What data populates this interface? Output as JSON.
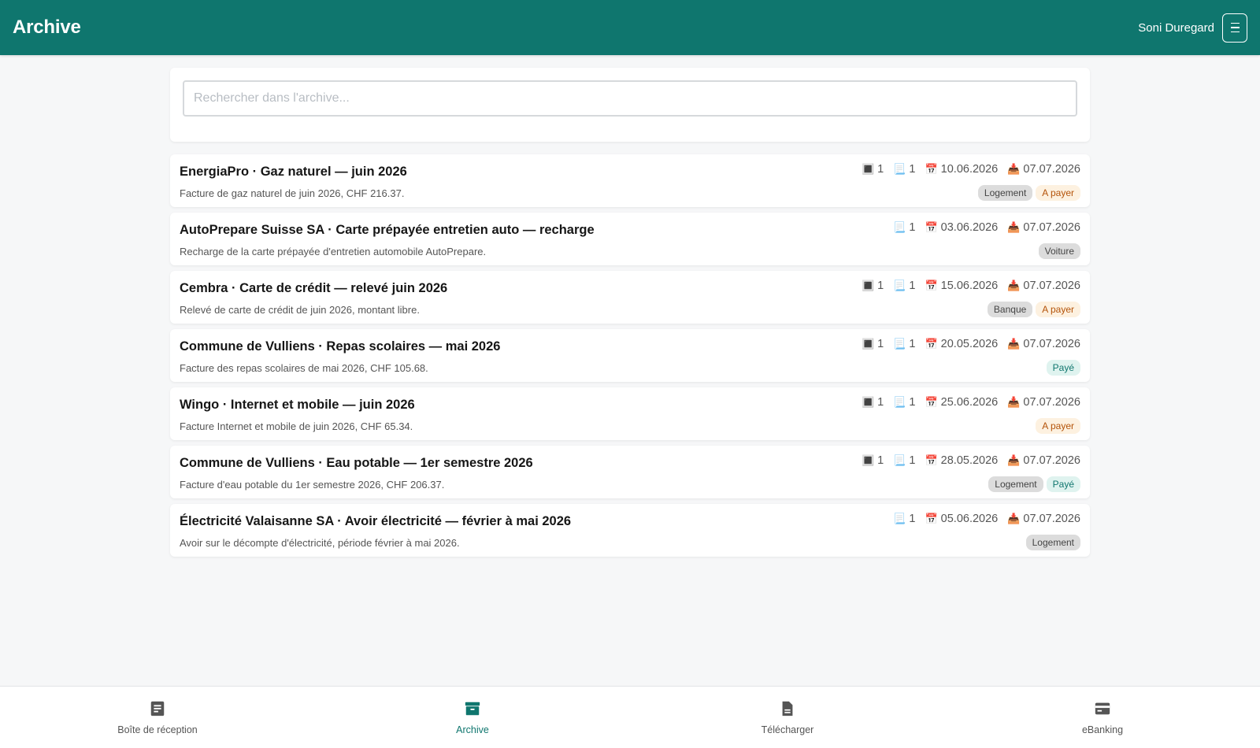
{
  "header": {
    "title": "Archive",
    "user_name": "Soni Duregard",
    "menu_icon": "hamburger-icon"
  },
  "search": {
    "placeholder": "Rechercher dans l'archive..."
  },
  "items": [
    {
      "title": "EnergiaPro · Gaz naturel — juin 2026",
      "description": "Facture de gaz naturel de juin 2026, CHF 216.37.",
      "qr": "1",
      "docs": "1",
      "date": "10.06.2026",
      "received": "07.07.2026",
      "tags": [
        {
          "label": "Logement",
          "kind": "neutral"
        },
        {
          "label": "A payer",
          "kind": "due"
        }
      ]
    },
    {
      "title": "AutoPrepare Suisse SA · Carte prépayée entretien auto — recharge",
      "description": "Recharge de la carte prépayée d'entretien automobile AutoPrepare.",
      "qr": null,
      "docs": "1",
      "date": "03.06.2026",
      "received": "07.07.2026",
      "tags": [
        {
          "label": "Voiture",
          "kind": "neutral"
        }
      ]
    },
    {
      "title": "Cembra · Carte de crédit — relevé juin 2026",
      "description": "Relevé de carte de crédit de juin 2026, montant libre.",
      "qr": "1",
      "docs": "1",
      "date": "15.06.2026",
      "received": "07.07.2026",
      "tags": [
        {
          "label": "Banque",
          "kind": "neutral"
        },
        {
          "label": "A payer",
          "kind": "due"
        }
      ]
    },
    {
      "title": "Commune de Vulliens · Repas scolaires — mai 2026",
      "description": "Facture des repas scolaires de mai 2026, CHF 105.68.",
      "qr": "1",
      "docs": "1",
      "date": "20.05.2026",
      "received": "07.07.2026",
      "tags": [
        {
          "label": "Payé",
          "kind": "paid"
        }
      ]
    },
    {
      "title": "Wingo · Internet et mobile — juin 2026",
      "description": "Facture Internet et mobile de juin 2026, CHF 65.34.",
      "qr": "1",
      "docs": "1",
      "date": "25.06.2026",
      "received": "07.07.2026",
      "tags": [
        {
          "label": "A payer",
          "kind": "due"
        }
      ]
    },
    {
      "title": "Commune de Vulliens · Eau potable — 1er semestre 2026",
      "description": "Facture d'eau potable du 1er semestre 2026, CHF 206.37.",
      "qr": "1",
      "docs": "1",
      "date": "28.05.2026",
      "received": "07.07.2026",
      "tags": [
        {
          "label": "Logement",
          "kind": "neutral"
        },
        {
          "label": "Payé",
          "kind": "paid"
        }
      ]
    },
    {
      "title": "Électricité Valaisanne SA · Avoir électricité — février à mai 2026",
      "description": "Avoir sur le décompte d'électricité, période février à mai 2026.",
      "qr": null,
      "docs": "1",
      "date": "05.06.2026",
      "received": "07.07.2026",
      "tags": [
        {
          "label": "Logement",
          "kind": "neutral"
        }
      ]
    }
  ],
  "meta_icons": {
    "qr": "qr-code-icon",
    "docs": "document-icon",
    "date": "calendar-icon",
    "received": "inbox-tray-icon"
  },
  "bottom_nav": [
    {
      "label": "Boîte de réception",
      "icon": "inbox-list-icon",
      "active": false
    },
    {
      "label": "Archive",
      "icon": "archive-box-icon",
      "active": true
    },
    {
      "label": "Télécharger",
      "icon": "file-icon",
      "active": false
    },
    {
      "label": "eBanking",
      "icon": "credit-card-icon",
      "active": false
    }
  ],
  "colors": {
    "primary": "#0f766e",
    "due_text": "#b45309",
    "due_bg": "#fdf1e0",
    "paid_bg": "#dff3ef",
    "neutral_bg": "#dcdcdc"
  }
}
